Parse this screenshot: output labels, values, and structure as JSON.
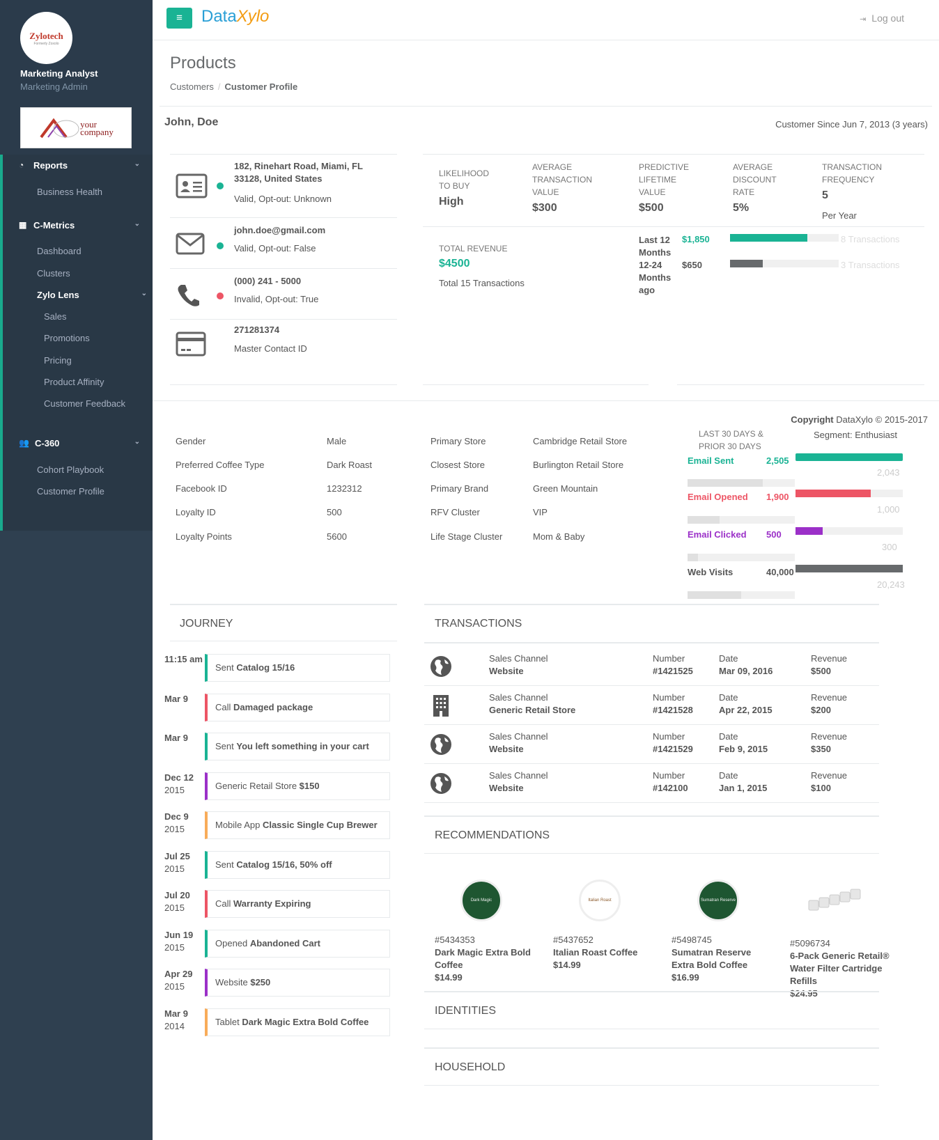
{
  "sidebar": {
    "logo_text": "Zylotech",
    "logo_sub": "Formerly Zoxolo",
    "user_name": "Marketing Analyst",
    "user_role": "Marketing Admin",
    "company_logo_line1": "your",
    "company_logo_line2": "company",
    "nav": {
      "reports": "Reports",
      "business_health": "Business Health",
      "cmetrics": "C-Metrics",
      "dashboard": "Dashboard",
      "clusters": "Clusters",
      "zylo_lens": "Zylo Lens",
      "sales": "Sales",
      "promotions": "Promotions",
      "pricing": "Pricing",
      "product_affinity": "Product Affinity",
      "customer_feedback": "Customer Feedback",
      "c360": "C-360",
      "cohort_playbook": "Cohort Playbook",
      "customer_profile": "Customer Profile"
    }
  },
  "topbar": {
    "menu_icon": "≡",
    "brand_a": "Data",
    "brand_b": "Xylo",
    "logout": "Log out"
  },
  "page": {
    "title": "Products",
    "breadcrumb_1": "Customers",
    "breadcrumb_sep": "/",
    "breadcrumb_2": "Customer Profile"
  },
  "customer": {
    "name": "John, Doe",
    "since": "Customer Since Jun 7, 2013 (3 years)"
  },
  "contacts": [
    {
      "l1": "182, Rinehart Road, Miami, FL 33128, United States",
      "l2": "Valid, Opt-out: Unknown",
      "status_color": "#1ab394"
    },
    {
      "l1": "john.doe@gmail.com",
      "l2": "Valid, Opt-out: False",
      "status_color": "#1ab394"
    },
    {
      "l1": "(000) 241 - 5000",
      "l2": "Invalid, Opt-out: True",
      "status_color": "#ed5565"
    },
    {
      "l1": "271281374",
      "l2": "Master Contact ID"
    }
  ],
  "metrics": {
    "likelihood_label_1": "LIKELIHOOD",
    "likelihood_label_2": "TO BUY",
    "likelihood_value": "High",
    "atv_label_1": "AVERAGE",
    "atv_label_2": "TRANSACTION",
    "atv_label_3": "VALUE",
    "atv_value": "$300",
    "plv_label_1": "PREDICTIVE",
    "plv_label_2": "LIFETIME",
    "plv_label_3": "VALUE",
    "plv_value": "$500",
    "adr_label_1": "AVERAGE",
    "adr_label_2": "DISCOUNT",
    "adr_label_3": "RATE",
    "adr_value": "5%",
    "tf_label_1": "TRANSACTION",
    "tf_label_2": "FREQUENCY",
    "tf_value": "5",
    "tf_unit": "Per Year"
  },
  "revenue": {
    "label": "TOTAL REVENUE",
    "value": "$4500",
    "note": "Total 15 Transactions",
    "period1_a": "Last 12",
    "period1_b": "Months",
    "period1_value": "$1,850",
    "period1_count": "8 Transactions",
    "period1_fraction": 0.71,
    "period2_a": "12-24",
    "period2_b": "Months",
    "period2_c": "ago",
    "period2_value": "$650",
    "period2_count": "3 Transactions",
    "period2_fraction": 0.3
  },
  "copyright": {
    "bold": "Copyright",
    "rest": "DataXylo © 2015-2017"
  },
  "attributes_left": [
    {
      "k": "Gender",
      "v": "Male"
    },
    {
      "k": "Preferred Coffee Type",
      "v": "Dark Roast"
    },
    {
      "k": "Facebook ID",
      "v": "1232312"
    },
    {
      "k": "Loyalty ID",
      "v": "500"
    },
    {
      "k": "Loyalty Points",
      "v": "5600"
    }
  ],
  "attributes_right": [
    {
      "k": "Primary Store",
      "v": "Cambridge Retail Store"
    },
    {
      "k": "Closest Store",
      "v": "Burlington Retail Store"
    },
    {
      "k": "Primary Brand",
      "v": "Green Mountain"
    },
    {
      "k": "RFV Cluster",
      "v": "VIP"
    },
    {
      "k": "Life Stage Cluster",
      "v": "Mom & Baby"
    }
  ],
  "engagement": {
    "header_left_1": "LAST 30 DAYS &",
    "header_left_2": "PRIOR 30 DAYS",
    "header_right": "Segment: Enthusiast",
    "rows": [
      {
        "label": "Email Sent",
        "value": "2,505",
        "segment": "2,043",
        "color": "#1ab394",
        "fill": 1.0,
        "prior_fill": 0.7
      },
      {
        "label": "Email Opened",
        "value": "1,900",
        "segment": "1,000",
        "color": "#ed5565",
        "fill": 0.7,
        "prior_fill": 0.3
      },
      {
        "label": "Email Clicked",
        "value": "500",
        "segment": "300",
        "color": "#9b30c8",
        "fill": 0.25,
        "prior_fill": 0.1
      },
      {
        "label": "Web Visits",
        "value": "40,000",
        "segment": "20,243",
        "color": "#676a6c",
        "fill": 1.0,
        "prior_fill": 0.5
      }
    ]
  },
  "journey": {
    "title": "JOURNEY",
    "items": [
      {
        "date": "11:15 am",
        "year": "",
        "pre": "Sent ",
        "bold": "Catalog 15/16",
        "color": "#1ab394"
      },
      {
        "date": "Mar 9",
        "year": "",
        "pre": "Call ",
        "bold": "Damaged package",
        "color": "#ed5565"
      },
      {
        "date": "Mar 9",
        "year": "",
        "pre": "Sent ",
        "bold": "You left something in your cart",
        "color": "#1ab394"
      },
      {
        "date": "Dec 12",
        "year": "2015",
        "pre": "Generic Retail Store ",
        "bold": "$150",
        "color": "#9b30c8"
      },
      {
        "date": "Dec 9",
        "year": "2015",
        "pre": "Mobile App ",
        "bold": "Classic Single Cup Brewer",
        "color": "#f8ac59"
      },
      {
        "date": "Jul 25",
        "year": "2015",
        "pre": "Sent ",
        "bold": "Catalog 15/16, 50% off",
        "color": "#1ab394"
      },
      {
        "date": "Jul 20",
        "year": "2015",
        "pre": "Call ",
        "bold": "Warranty Expiring",
        "color": "#ed5565"
      },
      {
        "date": "Jun 19",
        "year": "2015",
        "pre": "Opened ",
        "bold": "Abandoned Cart",
        "color": "#1ab394"
      },
      {
        "date": "Apr 29",
        "year": "2015",
        "pre": "Website ",
        "bold": "$250",
        "color": "#9b30c8"
      },
      {
        "date": "Mar 9",
        "year": "2014",
        "pre": "Tablet ",
        "bold": "Dark Magic Extra Bold Coffee",
        "color": "#f8ac59"
      }
    ]
  },
  "transactions": {
    "title": "TRANSACTIONS",
    "channel_label": "Sales Channel",
    "number_label": "Number",
    "date_label": "Date",
    "revenue_label": "Revenue",
    "rows": [
      {
        "icon": "globe-icon",
        "channel": "Website",
        "number": "#1421525",
        "date": "Mar 09, 2016",
        "revenue": "$500"
      },
      {
        "icon": "building-icon",
        "channel": "Generic Retail Store",
        "number": "#1421528",
        "date": "Apr 22, 2015",
        "revenue": "$200"
      },
      {
        "icon": "globe-icon",
        "channel": "Website",
        "number": "#1421529",
        "date": "Feb 9, 2015",
        "revenue": "$350"
      },
      {
        "icon": "globe-icon",
        "channel": "Website",
        "number": "#142100",
        "date": "Jan 1, 2015",
        "revenue": "$100"
      }
    ]
  },
  "recommendations": {
    "title": "RECOMMENDATIONS",
    "items": [
      {
        "sku": "#5434353",
        "name": "Dark Magic Extra Bold Coffee",
        "price": "$14.99",
        "pod_label": "Dark Magic"
      },
      {
        "sku": "#5437652",
        "name": "Italian Roast Coffee",
        "price": "$14.99",
        "pod_label": "Italian Roast"
      },
      {
        "sku": "#5498745",
        "name": "Sumatran Reserve Extra Bold Coffee",
        "price": "$16.99",
        "pod_label": "Sumatran Reserve"
      },
      {
        "sku": "#5096734",
        "name": "6-Pack Generic Retail® Water Filter Cartridge Refills",
        "price": "$24.95",
        "pod_label": ""
      }
    ]
  },
  "identities_title": "IDENTITIES",
  "household_title": "HOUSEHOLD"
}
